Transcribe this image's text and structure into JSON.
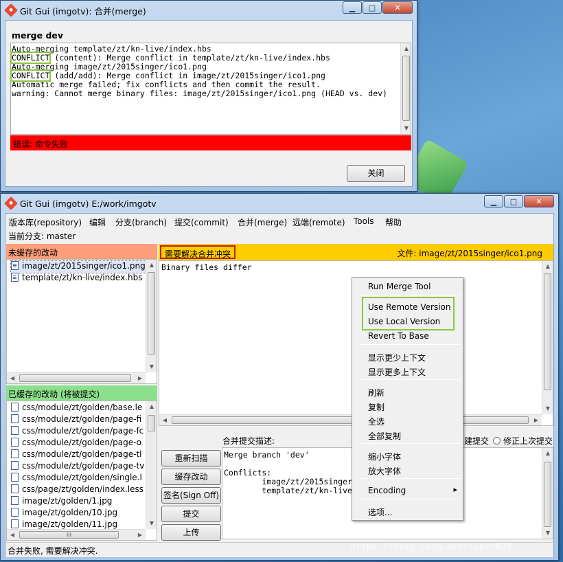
{
  "dialog": {
    "title": "Git Gui (imgotv): 合并(merge)",
    "heading": "merge dev",
    "log_lines": [
      {
        "text": "Auto-merging template/zt/kn-live/index.hbs",
        "tag": ""
      },
      {
        "text": " (content): Merge conflict in template/zt/kn-live/index.hbs",
        "tag": "CONFLICT"
      },
      {
        "text": "Auto-merging image/zt/2015singer/ico1.png",
        "tag": ""
      },
      {
        "text": " (add/add): Merge conflict in image/zt/2015singer/ico1.png",
        "tag": "CONFLICT"
      },
      {
        "text": "Automatic merge failed; fix conflicts and then commit the result.",
        "tag": ""
      },
      {
        "text": "warning: Cannot merge binary files: image/zt/2015singer/ico1.png (HEAD vs. dev)",
        "tag": ""
      }
    ],
    "error_text": "错误: 命令失败",
    "close_label": "关闭",
    "error_color": "#ff0000"
  },
  "main": {
    "title": "Git Gui (imgotv) E:/work/imgotv",
    "menubar": [
      "版本库(repository)",
      "编辑",
      "分支(branch)",
      "提交(commit)",
      "合并(merge)",
      "远端(remote)",
      "Tools",
      "帮助"
    ],
    "current_branch": "当前分支: master",
    "unstaged_header": "未缓存的改动",
    "unstaged_color": "#ff9e7a",
    "unstaged_files": [
      "image/zt/2015singer/ico1.png",
      "template/zt/kn-live/index.hbs"
    ],
    "staged_header": "已缓存的改动 (将被提交)",
    "staged_color": "#8ce08c",
    "staged_files": [
      "css/module/zt/golden/base.le",
      "css/module/zt/golden/page-fi",
      "css/module/zt/golden/page-fc",
      "css/module/zt/golden/page-o",
      "css/module/zt/golden/page-tl",
      "css/module/zt/golden/page-tv",
      "css/module/zt/golden/single.l",
      "css/page/zt/golden/index.less",
      "image/zt/golden/1.jpg",
      "image/zt/golden/10.jpg",
      "image/zt/golden/11.jpg"
    ],
    "staged_hscroll_glyph": "III",
    "diff_header_left": "需要解决合并冲突",
    "diff_header_right": "文件:  image/zt/2015singer/ico1.png",
    "diff_header_color": "#ffcc00",
    "diff_text": "Binary files differ",
    "commit_label": "合并提交描述:",
    "commit_text": [
      "Merge branch 'dev'",
      "",
      "Conflicts:",
      "        image/zt/2015singer",
      "        template/zt/kn-live"
    ],
    "radio_new": "建提交",
    "radio_amend": "修正上次提交",
    "buttons": [
      "重新扫描",
      "缓存改动",
      "签名(Sign Off)",
      "提交",
      "上传"
    ],
    "status": "合并失败, 需要解决冲突."
  },
  "context_menu": {
    "items": [
      "Run Merge Tool",
      "Use Remote Version",
      "Use Local Version",
      "Revert To Base",
      "显示更少上下文",
      "显示更多上下文",
      "刷新",
      "复制",
      "全选",
      "全部复制",
      "缩小字体",
      "放大字体",
      "Encoding",
      "选项..."
    ],
    "submenu_arrow": "▸"
  },
  "watermark": "https://blog.csdn.net/super828",
  "highlight_color": "#8cc63f"
}
